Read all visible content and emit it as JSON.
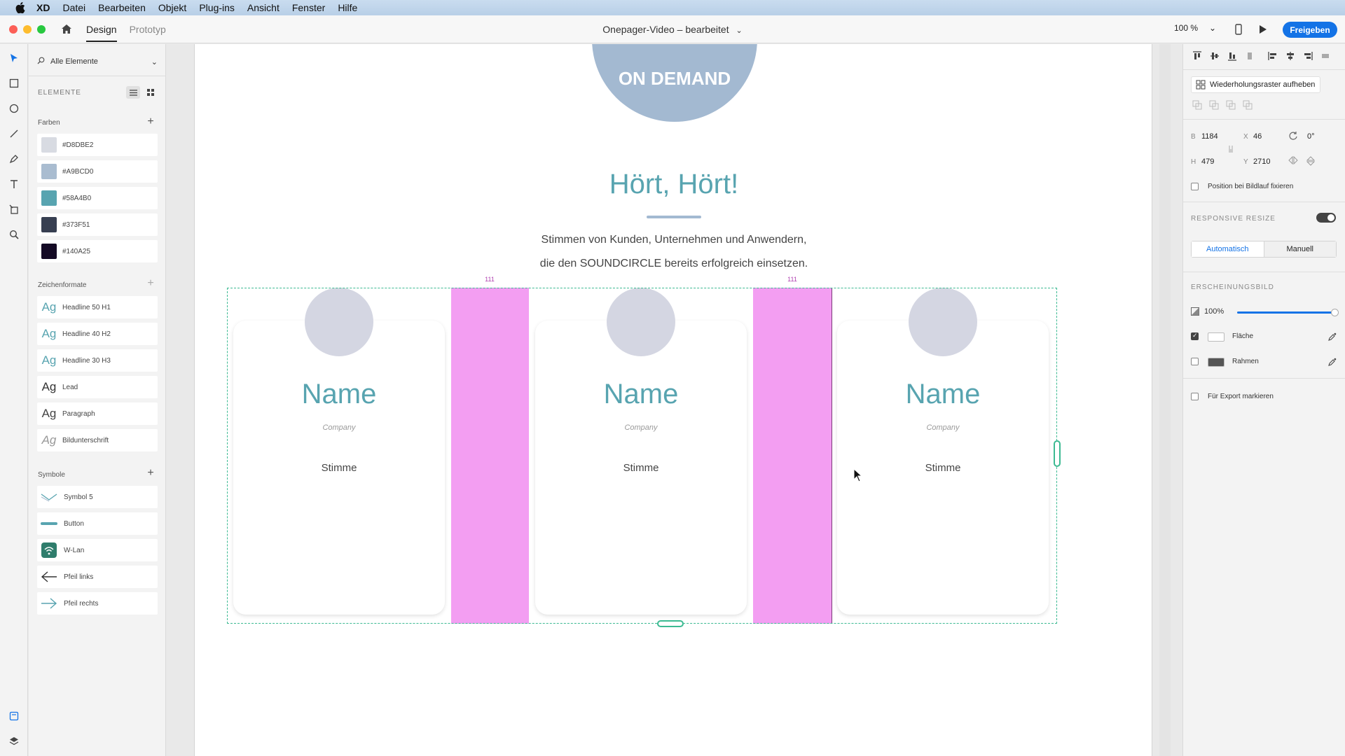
{
  "menubar": {
    "app": "XD",
    "items": [
      "Datei",
      "Bearbeiten",
      "Objekt",
      "Plug-ins",
      "Ansicht",
      "Fenster",
      "Hilfe"
    ]
  },
  "titlebar": {
    "tabs": [
      "Design",
      "Prototyp"
    ],
    "document_title": "Onepager-Video – bearbeitet",
    "zoom": "100 %",
    "share_label": "Freigeben"
  },
  "assets": {
    "filter_label": "Alle Elemente",
    "section_title": "ELEMENTE",
    "colors_title": "Farben",
    "colors": [
      {
        "label": "#D8DBE2",
        "hex": "#D8DBE2"
      },
      {
        "label": "#A9BCD0",
        "hex": "#A9BCD0"
      },
      {
        "label": "#58A4B0",
        "hex": "#58A4B0"
      },
      {
        "label": "#373F51",
        "hex": "#373F51"
      },
      {
        "label": "#140A25",
        "hex": "#140A25"
      }
    ],
    "char_title": "Zeichenformate",
    "char_styles": [
      {
        "glyph": "Ag",
        "label": "Headline 50 H1"
      },
      {
        "glyph": "Ag",
        "label": "Headline 40 H2"
      },
      {
        "glyph": "Ag",
        "label": "Headline 30 H3"
      },
      {
        "glyph": "Ag",
        "label": "Lead"
      },
      {
        "glyph": "Ag",
        "label": "Paragraph"
      },
      {
        "glyph": "Ag",
        "label": "Bildunterschrift"
      }
    ],
    "symbols_title": "Symbole",
    "symbols": [
      {
        "icon": "chevron-wave-icon",
        "label": "Symbol 5"
      },
      {
        "icon": "button-bar-icon",
        "label": "Button"
      },
      {
        "icon": "wifi-icon",
        "label": "W-Lan"
      },
      {
        "icon": "arrow-left-icon",
        "label": "Pfeil links"
      },
      {
        "icon": "arrow-right-icon",
        "label": "Pfeil rechts"
      }
    ]
  },
  "artboard": {
    "badge_text": "ON DEMAND",
    "headline": "Hört, Hört!",
    "lead_line1": "Stimmen von Kunden, Unternehmen und Anwendern,",
    "lead_line2": "die den SOUNDCIRCLE bereits erfolgreich einsetzen.",
    "gap_label": "111",
    "cards": [
      {
        "name": "Name",
        "company": "Company",
        "voice": "Stimme"
      },
      {
        "name": "Name",
        "company": "Company",
        "voice": "Stimme"
      },
      {
        "name": "Name",
        "company": "Company",
        "voice": "Stimme"
      }
    ]
  },
  "properties": {
    "ungroup_label": "Wiederholungsraster aufheben",
    "w_label": "B",
    "w_value": "1184",
    "x_label": "X",
    "x_value": "46",
    "rot_value": "0°",
    "h_label": "H",
    "h_value": "479",
    "y_label": "Y",
    "y_value": "2710",
    "fix_scroll": "Position bei Bildlauf fixieren",
    "responsive_title": "RESPONSIVE RESIZE",
    "seg_auto": "Automatisch",
    "seg_manual": "Manuell",
    "appearance_title": "ERSCHEINUNGSBILD",
    "opacity": "100%",
    "opacity_fraction": 1.0,
    "fill_label": "Fläche",
    "border_label": "Rahmen",
    "export_label": "Für Export markieren"
  },
  "colors": {
    "accent": "#58A4B0",
    "selection": "#3CBA92",
    "gap": "#F39EF2",
    "primary_blue": "#1473E6",
    "avatar": "#D4D6E2",
    "badge": "#A3B9D1"
  }
}
